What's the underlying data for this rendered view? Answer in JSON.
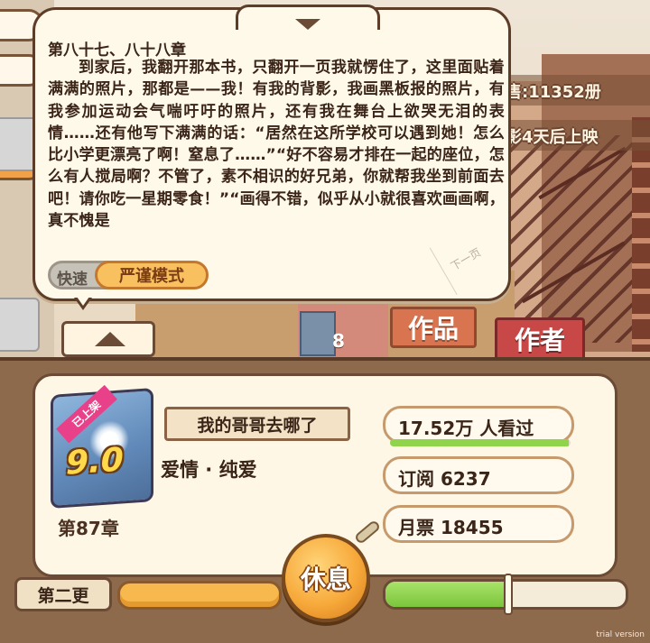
{
  "hud": {
    "sales_label": "售:11352册",
    "movie_label": "影4天后上映",
    "page_count": "8",
    "works_sign": "作品",
    "author_sign": "作者"
  },
  "dialog": {
    "chapter_title": "第八十七、八十八章",
    "text": "到家后，我翻开那本书，只翻开一页我就愣住了，这里面贴着满满的照片，那都是——我！有我的背影，我画黑板报的照片，有我参加运动会气喘吁吁的照片，还有我在舞台上欲哭无泪的表情……还有他写下满满的话：“居然在这所学校可以遇到她！怎么比小学更漂亮了啊！窒息了……”“好不容易才排在一起的座位，怎么有人搅局啊？不管了，素不相识的好兄弟，你就帮我坐到前面去吧！请你吃一星期零食！”“画得不错，似乎从小就很喜欢画画啊，真不愧是",
    "mode_quick": "快速",
    "mode_strict": "严谨模式",
    "next_page": "下一页"
  },
  "book": {
    "ribbon": "已上架",
    "score": "9.0",
    "title": "我的哥哥去哪了",
    "genre": "爱情 · 纯爱",
    "chapter": "第87章"
  },
  "stats": {
    "views": "17.52万 人看过",
    "views_fraction": 0.99,
    "subscriptions": "订阅 6237",
    "monthly_tickets": "月票 18455"
  },
  "controls": {
    "rest": "休息",
    "second_update": "第二更",
    "progress_fraction": 0.5
  },
  "watermark": "trial version"
}
